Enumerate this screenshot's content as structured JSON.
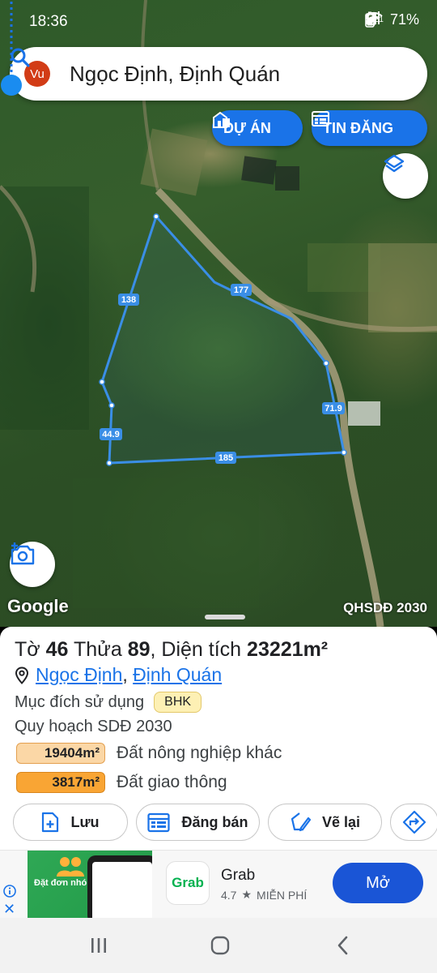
{
  "status_bar": {
    "time": "18:36",
    "network": "LTE1",
    "battery": "71%"
  },
  "search": {
    "avatar_initials": "Vu",
    "query": "Ngọc Định, Định Quán"
  },
  "map": {
    "buttons": {
      "projects": "DỰ ÁN",
      "listings": "TIN ĐĂNG"
    },
    "edge_labels": [
      "138",
      "177",
      "71.9",
      "185",
      "44.9"
    ],
    "attribution": "Google",
    "layer_label": "QHSDĐ 2030"
  },
  "parcel": {
    "sheet_prefix": "Tờ",
    "sheet_no": "46",
    "plot_prefix": "Thửa",
    "plot_no": "89",
    "area_prefix": ", Diện tích",
    "area": "23221m²",
    "commune": "Ngọc Định",
    "district": "Định Quán",
    "purpose_label": "Mục đích sử dụng",
    "purpose_code": "BHK",
    "plan_label": "Quy hoạch SDĐ 2030",
    "land_uses": [
      {
        "area": "19404m²",
        "name": "Đất nông nghiệp khác",
        "color": "#fbd7a6"
      },
      {
        "area": "3817m²",
        "name": "Đất giao thông",
        "color": "#f9a534"
      }
    ]
  },
  "actions": {
    "save": "Lưu",
    "sell": "Đăng bán",
    "redraw": "Vẽ lại"
  },
  "ad": {
    "creative_headline": "Đặt đơn nhóm",
    "app_name": "Grab",
    "logo_text": "Grab",
    "rating": "4.7",
    "price": "MIỄN PHÍ",
    "cta": "Mở"
  },
  "colors": {
    "accent": "#1a73e8",
    "parcel_line": "#3a8ee6"
  }
}
